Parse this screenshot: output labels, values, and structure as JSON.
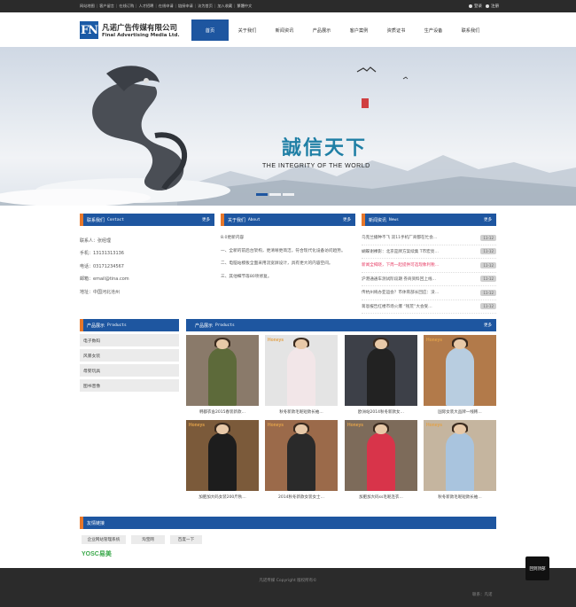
{
  "topbar": {
    "links": [
      "网站地图",
      "客户留言",
      "在线订购",
      "人才招聘",
      "在线申请",
      "链接申请",
      "访为首页",
      "加入收藏",
      "繁體中文"
    ],
    "login": "登录",
    "register": "注册"
  },
  "logo": {
    "mark": "FN",
    "cn": "凡诺广告传媒有限公司",
    "en": "Final Advertising Media Ltd."
  },
  "nav": {
    "items": [
      {
        "label": "首页",
        "active": true
      },
      {
        "label": "关于我们"
      },
      {
        "label": "新闻资讯"
      },
      {
        "label": "产品展示"
      },
      {
        "label": "客户案例"
      },
      {
        "label": "资质证书"
      },
      {
        "label": "生产设备"
      },
      {
        "label": "联系我们"
      }
    ]
  },
  "banner": {
    "slogan_cn": "誠信天下",
    "slogan_en": "THE INTEGRITY OF THE WORLD"
  },
  "contact": {
    "title": "联系我们",
    "en": "Contact",
    "more": "更多",
    "rows": [
      "联系人：张经理",
      "手机：13131313136",
      "电话：03171234567",
      "邮箱：email@tina.com",
      "地址：中国河北沧州"
    ]
  },
  "about": {
    "title": "关于我们",
    "en": "About",
    "more": "更多",
    "paras": [
      "8.0更新内容",
      "一、全新的前后台架构，更清晰更简洁，符合现代化设备访问趋势。",
      "二、电脑站模板全面采用流宽屏设计，具有更大的内容空间。",
      "三、其他细节等80项修复。"
    ]
  },
  "news": {
    "title": "新闻资讯",
    "en": "News",
    "more": "更多",
    "items": [
      {
        "text": "乌克兰播种不飞 双11手机厂商都在忙会…",
        "date": "11-12",
        "hl": false
      },
      {
        "text": "蝴蝶谢裸影：北京是牌方案续集 T市宏亮…",
        "date": "11-12",
        "hl": false
      },
      {
        "text": "新闻全揭晓，下周一起提供可选现象利税…",
        "date": "11-12",
        "hl": true
      },
      {
        "text": "沪港通通车测试阶段期 券商资料回上线…",
        "date": "11-12",
        "hl": false
      },
      {
        "text": "传杭州将办亚运会？市体育部长回应：没…",
        "date": "11-12",
        "hl": false
      },
      {
        "text": "蒋恩报告红楼市场火爆 “钱荒”大会受…",
        "date": "11-12",
        "hl": false
      }
    ]
  },
  "categories": {
    "title": "产品展示",
    "en": "Products",
    "items": [
      "电子数码",
      "风暴女装",
      "母婴玩具",
      "图书音像"
    ]
  },
  "products": {
    "title": "产品展示",
    "en": "Products",
    "more": "更多",
    "items": [
      {
        "name": "韩都衣舍2015春装新款…",
        "brand": "",
        "bg": "#8a7a6a",
        "coat": "#5d6a3a"
      },
      {
        "name": "秋冬新款毛呢短款长袖…",
        "brand": "Honeys",
        "bg": "#e4e4e4",
        "coat": "#f2e6e8"
      },
      {
        "name": "欧洲站2014秋冬新款女…",
        "brand": "",
        "bg": "#3d4048",
        "coat": "#222"
      },
      {
        "name": "国际女装大品牌一线韩…",
        "brand": "Honeys",
        "bg": "#b27a4a",
        "coat": "#b8cde0"
      },
      {
        "name": "加肥加大码女装200斤秋…",
        "brand": "Honeys",
        "bg": "#7b5a3a",
        "coat": "#1d1d1d"
      },
      {
        "name": "2014秋冬新款女装女士…",
        "brand": "Honeys",
        "bg": "#9b6a4a",
        "coat": "#2a2a2a"
      },
      {
        "name": "加肥加大码ss毛呢连衣…",
        "brand": "Honeys",
        "bg": "#7d6b5a",
        "coat": "#d8344a"
      },
      {
        "name": "秋冬新款毛呢短款长袖…",
        "brand": "Honeys",
        "bg": "#c5b59f",
        "coat": "#a9c4de"
      }
    ]
  },
  "friends": {
    "title": "友情链接",
    "items": [
      "企业网站管理系统",
      "淘宝网",
      "百度一下"
    ],
    "logo_text": "YOSC易美"
  },
  "footer": {
    "copy": "凡诺传媒 Copyright 版权所有©",
    "right": "联系：凡诺"
  },
  "backtop": "回到顶部"
}
